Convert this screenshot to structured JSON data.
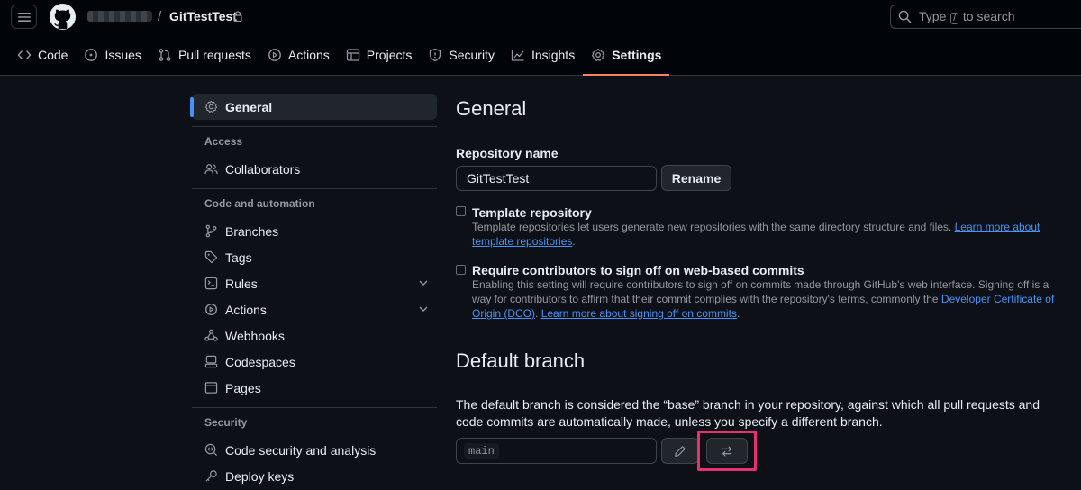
{
  "header": {
    "owner": "",
    "separator": "/",
    "repo": "GitTestTest",
    "search": {
      "prefix": "Type",
      "key": "/",
      "suffix": "to search"
    }
  },
  "tabs": [
    {
      "label": "Code",
      "icon": "code-icon"
    },
    {
      "label": "Issues",
      "icon": "issue-icon"
    },
    {
      "label": "Pull requests",
      "icon": "pull-request-icon"
    },
    {
      "label": "Actions",
      "icon": "play-icon"
    },
    {
      "label": "Projects",
      "icon": "table-icon"
    },
    {
      "label": "Security",
      "icon": "shield-icon"
    },
    {
      "label": "Insights",
      "icon": "graph-icon"
    },
    {
      "label": "Settings",
      "icon": "gear-icon",
      "active": true
    }
  ],
  "sidebar": {
    "general": "General",
    "access_heading": "Access",
    "collaborators": "Collaborators",
    "automation_heading": "Code and automation",
    "branches": "Branches",
    "tags": "Tags",
    "rules": "Rules",
    "actions": "Actions",
    "webhooks": "Webhooks",
    "codespaces": "Codespaces",
    "pages": "Pages",
    "security_heading": "Security",
    "code_security": "Code security and analysis",
    "deploy_keys": "Deploy keys"
  },
  "main": {
    "title": "General",
    "repo_name_label": "Repository name",
    "repo_name_value": "GitTestTest",
    "rename_button": "Rename",
    "template": {
      "label": "Template repository",
      "desc": "Template repositories let users generate new repositories with the same directory structure and files.",
      "link": "Learn more about template repositories",
      "suffix": "."
    },
    "signoff": {
      "label": "Require contributors to sign off on web-based commits",
      "desc": "Enabling this setting will require contributors to sign off on commits made through GitHub’s web interface. Signing off is a way for contributors to affirm that their commit complies with the repository's terms, commonly the",
      "dco_link": "Developer Certificate of Origin (DCO)",
      "dco_suffix": ".",
      "learn_link": "Learn more about signing off on commits",
      "learn_suffix": "."
    },
    "default_branch": {
      "title": "Default branch",
      "desc": "The default branch is considered the “base” branch in your repository, against which all pull requests and code commits are automatically made, unless you specify a different branch.",
      "branch": "main"
    }
  },
  "colors": {
    "background": "#0d1117",
    "accent": "#4493f8",
    "tab_underline": "#f78166",
    "highlight": "#e8306e"
  }
}
